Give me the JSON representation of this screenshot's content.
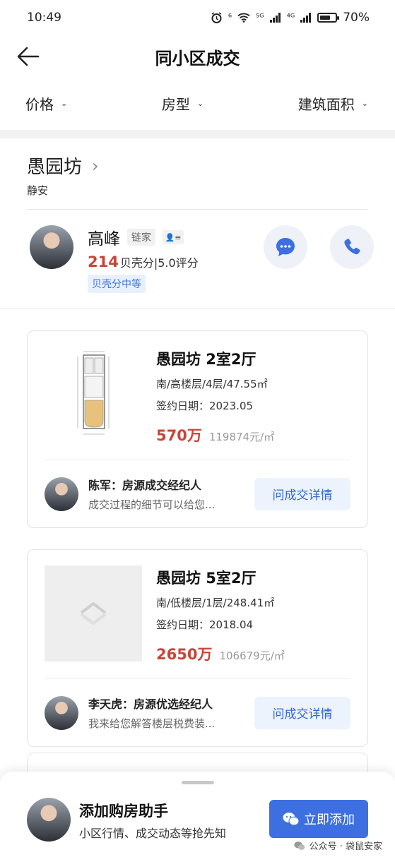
{
  "status_bar": {
    "time": "10:49",
    "signal_label_1": "⁶",
    "signal_label_2": "⁵ᴳ",
    "signal_label_3": "⁴ᴳ",
    "battery_pct": "70%",
    "battery_level": 0.7
  },
  "nav": {
    "title": "同小区成交"
  },
  "filters": [
    {
      "label": "价格"
    },
    {
      "label": "房型"
    },
    {
      "label": "建筑面积"
    }
  ],
  "community": {
    "name": "愚园坊",
    "district": "静安"
  },
  "agent": {
    "name": "高峰",
    "brand": "链家",
    "score": "214",
    "score_text": "贝壳分|5.0评分",
    "badge": "贝壳分中等"
  },
  "deals": [
    {
      "title": "愚园坊 2室2厅",
      "spec": "南/高楼层/4层/47.55㎡",
      "date": "签约日期：2023.05",
      "price": "570万",
      "unit_price": "119874元/㎡",
      "agent_name": "陈军：房源成交经纪人",
      "agent_msg": "成交过程的细节可以给您...",
      "button": "问成交详情"
    },
    {
      "title": "愚园坊 5室2厅",
      "spec": "南/低楼层/1层/248.41㎡",
      "date": "签约日期：2018.04",
      "price": "2650万",
      "unit_price": "106679元/㎡",
      "agent_name": "李天虎：房源优选经纪人",
      "agent_msg": "我来给您解答楼层税费装...",
      "button": "问成交详情"
    }
  ],
  "helper": {
    "title": "添加购房助手",
    "subtitle": "小区行情、成交动态等抢先知",
    "button": "立即添加"
  },
  "watermark": "公众号 · 袋鼠安家"
}
